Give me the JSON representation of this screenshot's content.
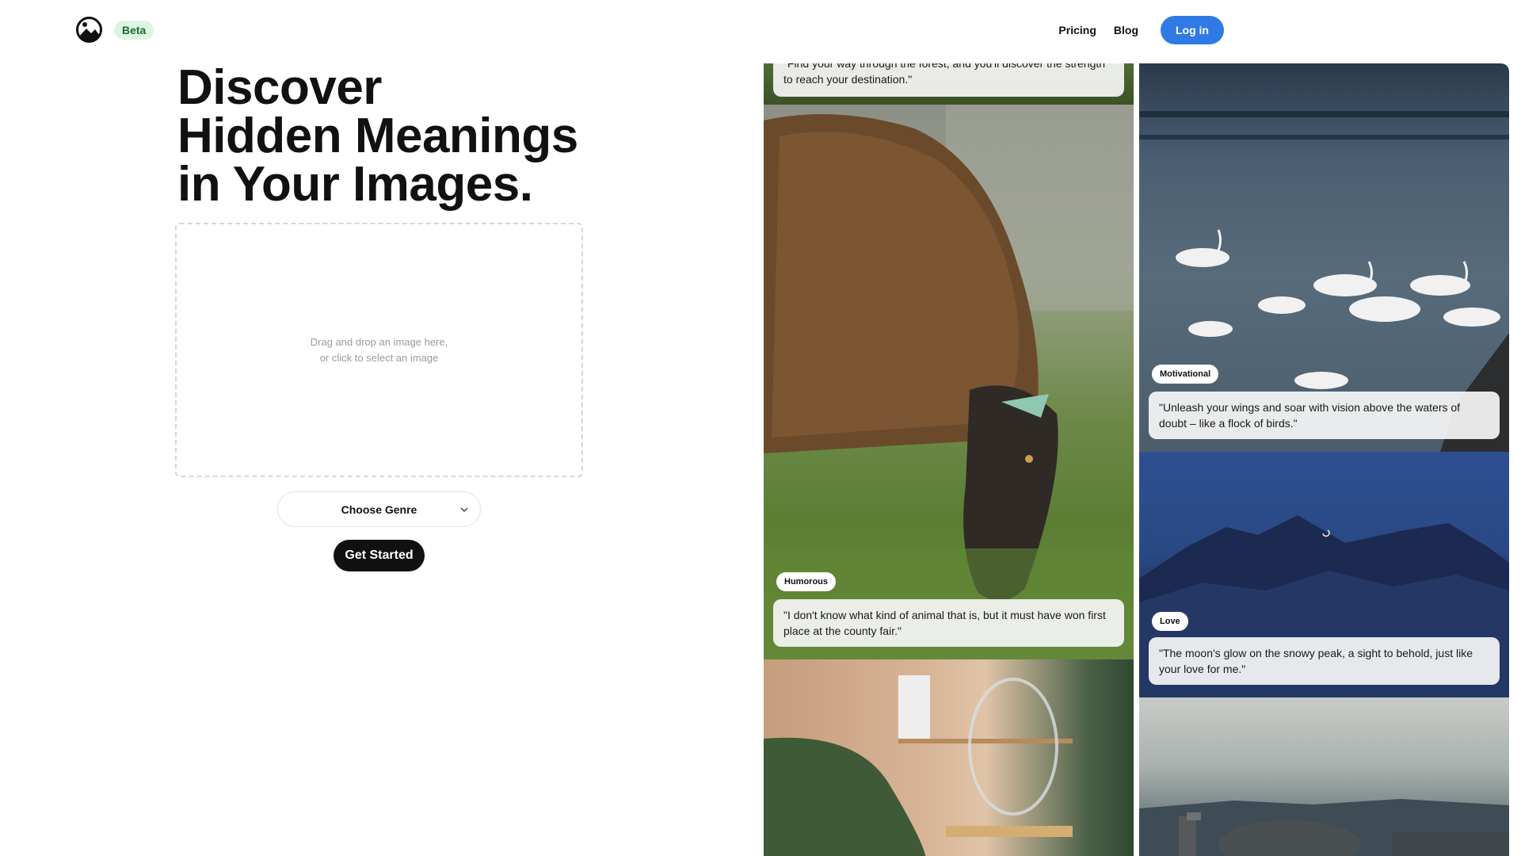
{
  "header": {
    "beta_label": "Beta",
    "nav": {
      "pricing": "Pricing",
      "blog": "Blog",
      "login": "Log in"
    }
  },
  "hero": {
    "headline_lines": [
      "Discover",
      "Hidden Meanings",
      "in Your Images."
    ],
    "dropzone_lines": [
      "Drag and drop an image here,",
      "or click to select an image"
    ],
    "genre_select": "Choose Genre",
    "cta": "Get Started"
  },
  "gallery": {
    "left": [
      {
        "tag": "",
        "quote_lines": [
          "\"Find your way through the forest, and you'll discover the strength",
          "to reach your destination.\""
        ]
      },
      {
        "tag": "Humorous",
        "quote_lines": [
          "\"I don't know what kind of animal that is, but it must have won first",
          "place at the county fair.\""
        ]
      }
    ],
    "right": [
      {
        "tag": "Motivational",
        "quote_lines": [
          "\"Unleash your wings and soar with vision above the waters of",
          "doubt – like a flock of birds.\""
        ]
      },
      {
        "tag": "Love",
        "quote_lines": [
          "\"The moon's glow on the snowy peak, a sight to behold, just like",
          "your love for me.\""
        ]
      }
    ]
  },
  "colors": {
    "accent_blue": "#2f7ae5",
    "beta_bg": "#dcf5e3",
    "beta_text": "#1c6b36",
    "cta_black": "#111111"
  }
}
